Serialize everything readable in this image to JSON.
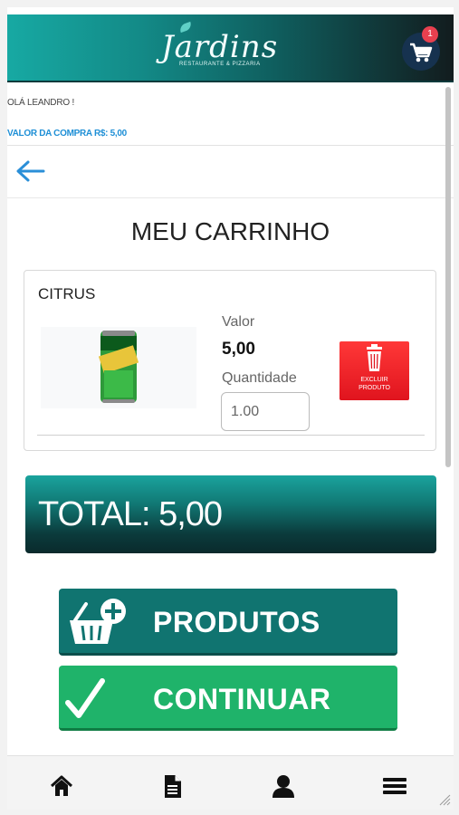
{
  "header": {
    "logo_text": "Jardins",
    "logo_subtitle": "RESTAURANTE & PIZZARIA",
    "cart_count": "1",
    "accent": "#16324f"
  },
  "user": {
    "greeting": "OLÁ LEANDRO !",
    "purchase_total": "VALOR DA COMPRA R$: 5,00"
  },
  "page": {
    "title": "MEU CARRINHO"
  },
  "cart_item": {
    "name": "CITRUS",
    "value_label": "Valor",
    "value": "5,00",
    "quantity_label": "Quantidade",
    "quantity": "1.00",
    "delete_label_line1": "EXCLUIR",
    "delete_label_line2": "PRODUTO",
    "delete_color": "#e0141e"
  },
  "total": {
    "text": "TOTAL: 5,00"
  },
  "actions": {
    "products_label": "PRODUTOS",
    "continue_label": "CONTINUAR",
    "products_color": "#107470",
    "continue_color": "#1fb36a"
  },
  "bottom_nav": {
    "items": [
      "home-icon",
      "document-icon",
      "user-icon",
      "menu-icon"
    ]
  }
}
